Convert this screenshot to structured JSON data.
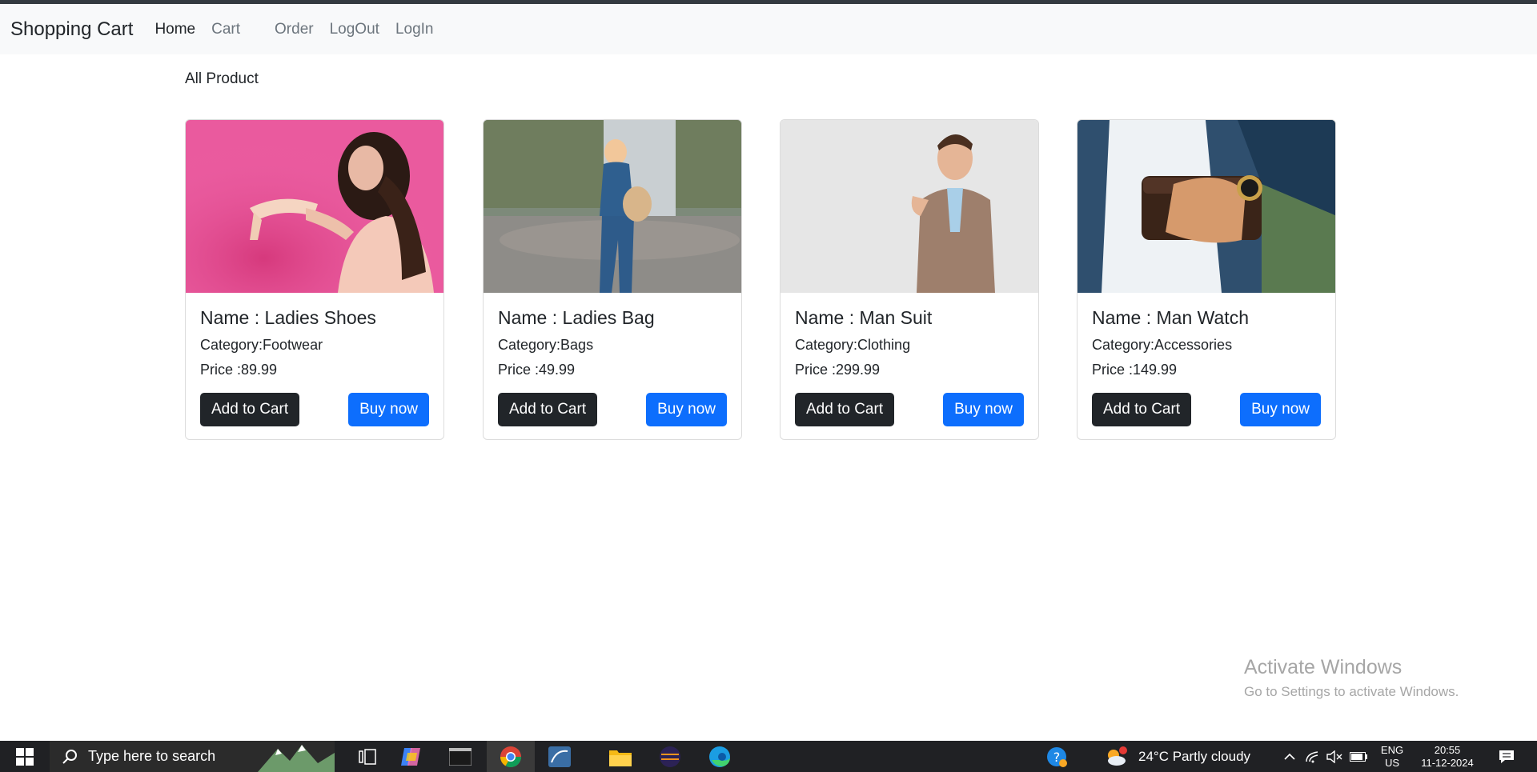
{
  "navbar": {
    "brand": "Shopping Cart",
    "links": [
      "Home",
      "Cart",
      "Order",
      "LogOut",
      "LogIn"
    ]
  },
  "section_title": "All Product",
  "products": [
    {
      "name": "Name : Ladies Shoes",
      "category": "Category:Footwear",
      "price": "Price :89.99",
      "add_label": "Add to Cart",
      "buy_label": "Buy now"
    },
    {
      "name": "Name : Ladies Bag",
      "category": "Category:Bags",
      "price": "Price :49.99",
      "add_label": "Add to Cart",
      "buy_label": "Buy now"
    },
    {
      "name": "Name : Man Suit",
      "category": "Category:Clothing",
      "price": "Price :299.99",
      "add_label": "Add to Cart",
      "buy_label": "Buy now"
    },
    {
      "name": "Name : Man Watch",
      "category": "Category:Accessories",
      "price": "Price :149.99",
      "add_label": "Add to Cart",
      "buy_label": "Buy now"
    }
  ],
  "watermark": {
    "line1": "Activate Windows",
    "line2": "Go to Settings to activate Windows."
  },
  "taskbar": {
    "search_placeholder": "Type here to search",
    "weather": "24°C  Partly cloudy",
    "lang_top": "ENG",
    "lang_bottom": "US",
    "time": "20:55",
    "date": "11-12-2024"
  },
  "colors": {
    "primary": "#0d6efd",
    "dark": "#212529",
    "navbar_bg": "#f8f9fa"
  }
}
